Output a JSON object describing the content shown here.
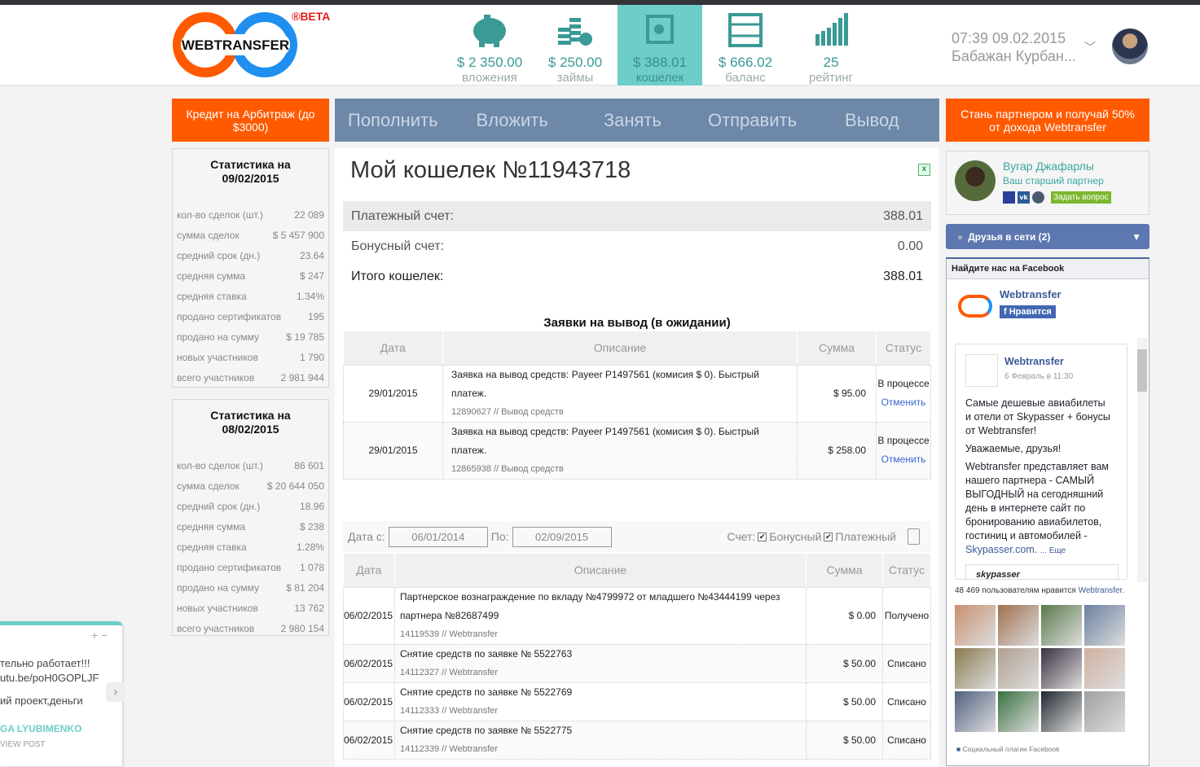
{
  "header": {
    "logo_text": "WEBTRANSFER",
    "beta": "®BETA",
    "stats": [
      {
        "value": "$ 2 350.00",
        "label": "вложения",
        "icon": "piggy-bank-icon"
      },
      {
        "value": "$ 250.00",
        "label": "займы",
        "icon": "coins-icon"
      },
      {
        "value": "$ 388.01",
        "label": "кошелек",
        "icon": "safe-icon"
      },
      {
        "value": "$ 666.02",
        "label": "баланс",
        "icon": "abacus-icon"
      },
      {
        "value": "25",
        "label": "рейтинг",
        "icon": "rating-chart-icon"
      }
    ],
    "datetime": "07:39 09.02.2015",
    "user": "Бабажан Курбан..."
  },
  "left": {
    "credit_button": "Кредит на Арбитраж (до $3000)",
    "stats": [
      {
        "title": "Статистика на 09/02/2015",
        "rows": [
          [
            "кол-во сделок (шт.)",
            "22 089"
          ],
          [
            "сумма сделок",
            "$ 5 457 900"
          ],
          [
            "средний срок (дн.)",
            "23.64"
          ],
          [
            "средняя сумма",
            "$ 247"
          ],
          [
            "средняя ставка",
            "1.34%"
          ],
          [
            "продано сертификатов",
            "195"
          ],
          [
            "продано на сумму",
            "$ 19 785"
          ],
          [
            "новых участников",
            "1 790"
          ],
          [
            "всего участников",
            "2 981 944"
          ]
        ]
      },
      {
        "title": "Статистика на 08/02/2015",
        "rows": [
          [
            "кол-во сделок (шт.)",
            "86 601"
          ],
          [
            "сумма сделок",
            "$ 20 644 050"
          ],
          [
            "средний срок (дн.)",
            "18.96"
          ],
          [
            "средняя сумма",
            "$ 238"
          ],
          [
            "средняя ставка",
            "1.28%"
          ],
          [
            "продано сертификатов",
            "1 078"
          ],
          [
            "продано на сумму",
            "$ 81 204"
          ],
          [
            "новых участников",
            "13 762"
          ],
          [
            "всего участников",
            "2 980 154"
          ]
        ]
      }
    ]
  },
  "nav": [
    "Пополнить",
    "Вложить",
    "Занять",
    "Отправить",
    "Вывод"
  ],
  "partner_button": "Стань партнером и получай 50% от дохода Webtransfer",
  "main": {
    "title": "Мой кошелек №11943718",
    "accounts": [
      [
        "Платежный счет:",
        "388.01"
      ],
      [
        "Бонусный счет:",
        "0.00"
      ],
      [
        "Итого кошелек:",
        "388.01"
      ]
    ],
    "pending_title": "Заявки на вывод (в ожидании)",
    "cols": [
      "Дата",
      "Описание",
      "Сумма",
      "Статус"
    ],
    "pending": [
      {
        "date": "29/01/2015",
        "desc": "Заявка на вывод средств: Payeer P1497561 (комисия $ 0). Быстрый платеж.",
        "sub": "12890627 // Вывод средств",
        "amount": "$ 95.00",
        "status": "В процессе",
        "action": "Отменить"
      },
      {
        "date": "29/01/2015",
        "desc": "Заявка на вывод средств: Payeer P1497561 (комисия $ 0). Быстрый платеж.",
        "sub": "12865938 // Вывод средств",
        "amount": "$ 258.00",
        "status": "В процессе",
        "action": "Отменить"
      }
    ],
    "filter": {
      "from_label": "Дата с:",
      "from": "06/01/2014",
      "to_label": "По:",
      "to": "02/09/2015",
      "account_label": "Счет:",
      "bonus": "Бонусный",
      "payment": "Платежный"
    },
    "history": [
      {
        "date": "06/02/2015",
        "desc": "Партнерское вознаграждение по вкладу №4799972 от младшего №43444199 через партнера №82687499",
        "sub": "14119539 // Webtransfer",
        "amount": "$ 0.00",
        "status": "Получено"
      },
      {
        "date": "06/02/2015",
        "desc": "Снятие средств по заявке № 5522763",
        "sub": "14112327 // Webtransfer",
        "amount": "$ 50.00",
        "status": "Списано"
      },
      {
        "date": "06/02/2015",
        "desc": "Снятие средств по заявке № 5522769",
        "sub": "14112333 // Webtransfer",
        "amount": "$ 50.00",
        "status": "Списано"
      },
      {
        "date": "06/02/2015",
        "desc": "Снятие средств по заявке № 5522775",
        "sub": "14112339 // Webtransfer",
        "amount": "$ 50.00",
        "status": "Списано"
      }
    ]
  },
  "right": {
    "partner_name": "Вугар Джафарлы",
    "partner_role": "Ваш старший партнер",
    "ask": "Задать вопрос",
    "friends": "Друзья в сети (2)",
    "fb": {
      "header": "Найдите нас на Facebook",
      "page": "Webtransfer",
      "like": "Нравится",
      "post_author": "Webtransfer",
      "post_date": "6 Февраль в 11:30",
      "p1": "Самые дешевые авиабилеты и отели от Skypasser + бонусы от Webtransfer!",
      "p2": "Уважаемые, друзья!",
      "p3": "Webtransfer представляет вам нашего партнера - САМЫЙ ВЫГОДНЫЙ на сегодняшний день в интернете сайт по бронированию авиабилетов, гостиниц и автомобилей -",
      "link": "Skypasser.com.",
      "more": "... Еще",
      "brand": "skypasser",
      "likes": "48 469 пользователям нравится",
      "likes_link": "Webtransfer.",
      "plugin": "Социальный плагин Facebook"
    }
  },
  "chat": {
    "l1": "тельно работает!!!",
    "l2": "utu.be/poH0GOPLJF",
    "l3": "ий проект,деньги",
    "author": "GA LYUBIMENKO",
    "view": "VIEW POST"
  }
}
